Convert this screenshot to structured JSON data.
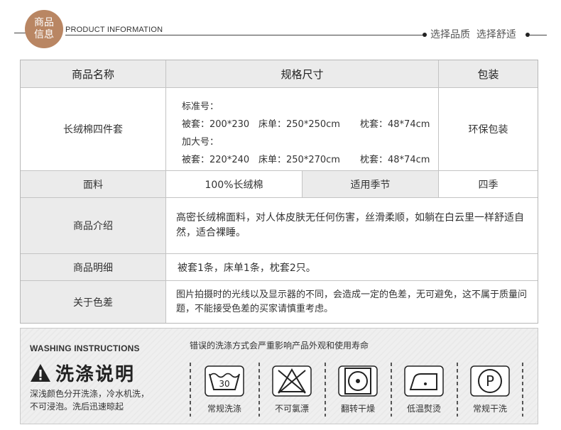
{
  "header": {
    "badge_line1": "商品",
    "badge_line2": "信息",
    "title_en": "PRODUCT INFORMATION",
    "tagline": "选择品质  选择舒适"
  },
  "table": {
    "col_headers": [
      "商品名称",
      "规格尺寸",
      "包装"
    ],
    "product_name": "长绒棉四件套",
    "spec": {
      "standard_label": "标准号：",
      "standard_duvet": "被套：200*230",
      "standard_sheet": "床单：250*250cm",
      "standard_pillow": "枕套：48*74cm",
      "large_label": "加大号：",
      "large_duvet": "被套：220*240",
      "large_sheet": "床单：250*270cm",
      "large_pillow": "枕套：48*74cm"
    },
    "packaging": "环保包装",
    "fabric_label": "面料",
    "fabric_value": "100%长绒棉",
    "season_label": "适用季节",
    "season_value": "四季",
    "intro_label": "商品介绍",
    "intro_value": "高密长绒棉面料，对人体皮肤无任何伤害，丝滑柔顺，如躺在白云里一样舒适自然，适合裸睡。",
    "detail_label": "商品明细",
    "detail_value": "被套1条，床单1条，枕套2只。",
    "color_label": "关于色差",
    "color_value": "图片拍摄时的光线以及显示器的不同，会造成一定的色差，无可避免，这不属于质量问题，不能接受色差的买家请慎重考虑。"
  },
  "washing": {
    "title_en": "WASHING INSTRUCTIONS",
    "title_cn": "洗涤说明",
    "desc_line1": "深浅颜色分开洗涤，冷水机洗，",
    "desc_line2": "不可浸泡。洗后迅速晾起",
    "note": "错误的洗涤方式会严重影响产品外观和使用寿命",
    "wash_temp": "30",
    "symbols": [
      {
        "icon": "washtub-30-icon",
        "label": "常规洗涤"
      },
      {
        "icon": "no-bleach-icon",
        "label": "不可氯漂"
      },
      {
        "icon": "tumble-dry-icon",
        "label": "翻转干燥"
      },
      {
        "icon": "iron-low-icon",
        "label": "低温熨烫"
      },
      {
        "icon": "dry-clean-p-icon",
        "label": "常规干洗"
      }
    ]
  },
  "colors": {
    "badge": "#b98663",
    "header_cell_bg": "#ebebeb",
    "wash_bg": "#efefef"
  }
}
